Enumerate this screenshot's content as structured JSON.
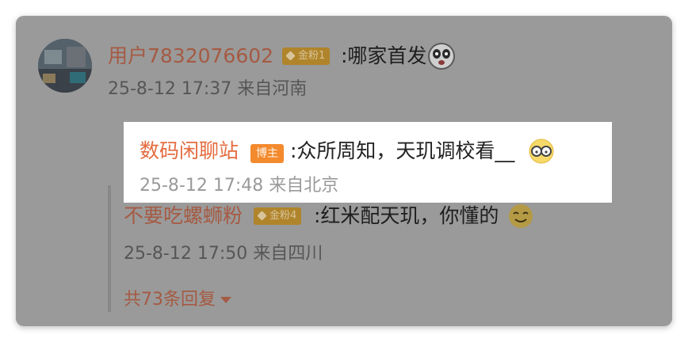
{
  "comment": {
    "username": "用户7832076602",
    "fan_badge": "金粉1",
    "text": ":哪家首发",
    "emoji": "panda-shocked-emoji",
    "meta": "25-8-12 17:37 来自河南"
  },
  "replies": [
    {
      "username": "数码闲聊站",
      "badge": "博主",
      "text": ":众所周知，天玑调校看__",
      "emoji": "glasses-emoji",
      "meta": "25-8-12 17:48 来自北京"
    },
    {
      "username": "不要吃螺蛳粉",
      "fan_badge": "金粉4",
      "text": ":红米配天玑，你懂的",
      "emoji": "smirk-emoji",
      "meta": "25-8-12 17:50 来自四川"
    }
  ],
  "more_replies": "共73条回复",
  "colors": {
    "overlay": "#9a9a9a",
    "highlight_name": "#e46b3f",
    "op_badge": "#f38a2e"
  }
}
